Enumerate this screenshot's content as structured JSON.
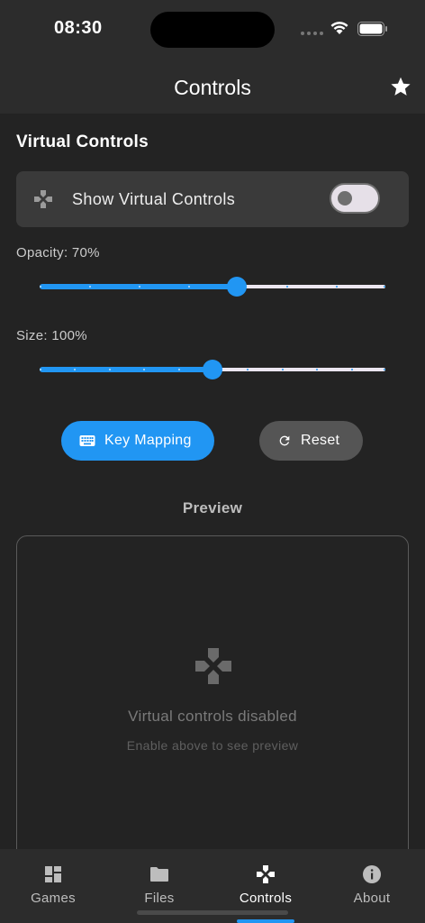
{
  "status_bar": {
    "time": "08:30"
  },
  "app_bar": {
    "title": "Controls",
    "favorite_icon": "star-icon"
  },
  "virtual_controls": {
    "section_title": "Virtual Controls",
    "toggle_label": "Show Virtual Controls",
    "toggle_on": false
  },
  "opacity": {
    "label": "Opacity: 70%",
    "value": 0.57,
    "divisions": 7
  },
  "size": {
    "label": "Size: 100%",
    "value": 0.5,
    "divisions": 10
  },
  "buttons": {
    "key_mapping": "Key Mapping",
    "reset": "Reset"
  },
  "preview": {
    "title": "Preview",
    "message": "Virtual controls disabled",
    "hint": "Enable above to see preview"
  },
  "nav": [
    {
      "label": "Games",
      "icon": "dashboard-icon",
      "active": false
    },
    {
      "label": "Files",
      "icon": "folder-icon",
      "active": false
    },
    {
      "label": "Controls",
      "icon": "gamepad-icon",
      "active": true
    },
    {
      "label": "About",
      "icon": "info-icon",
      "active": false
    }
  ],
  "colors": {
    "accent": "#2196f3",
    "background": "#232323",
    "surface": "#2c2c2c",
    "card": "#3a3a3a"
  }
}
